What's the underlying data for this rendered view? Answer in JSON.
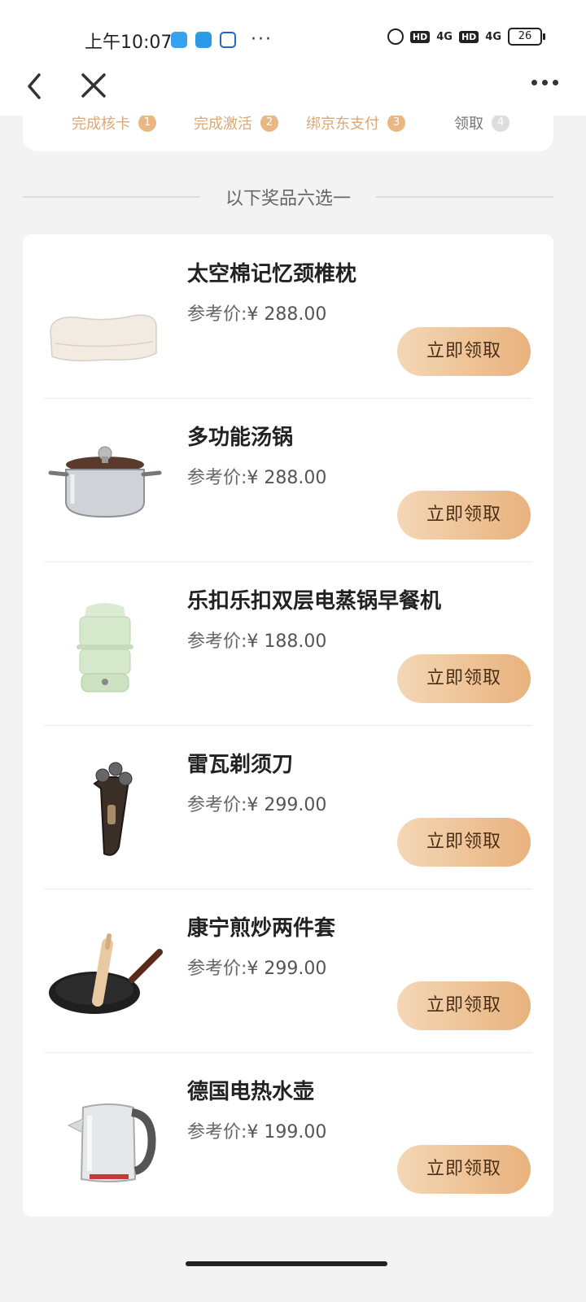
{
  "status_bar": {
    "time": "上午10:07",
    "dots": "···",
    "network_a": "4G",
    "network_b": "4G",
    "hd_label": "HD",
    "battery": "26"
  },
  "nav": {
    "back_icon": "chevron-left-icon",
    "close_icon": "close-icon",
    "more_icon": "more-icon"
  },
  "task_card": {
    "items": [
      {
        "label": "完成核卡",
        "badge": "1"
      },
      {
        "label": "完成激活",
        "badge": "2"
      },
      {
        "label": "绑京东支付",
        "badge": "3"
      },
      {
        "label": "领取",
        "badge": "4"
      }
    ]
  },
  "section": {
    "title": "以下奖品六选一"
  },
  "prizes": [
    {
      "name": "太空棉记忆颈椎枕",
      "price_label": "参考价:",
      "price": "¥ 288.00",
      "button": "立即领取",
      "icon": "pillow-icon"
    },
    {
      "name": "多功能汤锅",
      "price_label": "参考价:",
      "price": "¥ 288.00",
      "button": "立即领取",
      "icon": "pot-icon"
    },
    {
      "name": "乐扣乐扣双层电蒸锅早餐机",
      "price_label": "参考价:",
      "price": "¥ 188.00",
      "button": "立即领取",
      "icon": "steamer-icon"
    },
    {
      "name": "雷瓦剃须刀",
      "price_label": "参考价:",
      "price": "¥ 299.00",
      "button": "立即领取",
      "icon": "shaver-icon"
    },
    {
      "name": "康宁煎炒两件套",
      "price_label": "参考价:",
      "price": "¥ 299.00",
      "button": "立即领取",
      "icon": "frying-pan-icon"
    },
    {
      "name": "德国电热水壶",
      "price_label": "参考价:",
      "price": "¥ 199.00",
      "button": "立即领取",
      "icon": "kettle-icon"
    }
  ],
  "colors": {
    "button_start": "#f4d7b6",
    "button_end": "#e8b27d",
    "task_accent": "#d9a977"
  }
}
